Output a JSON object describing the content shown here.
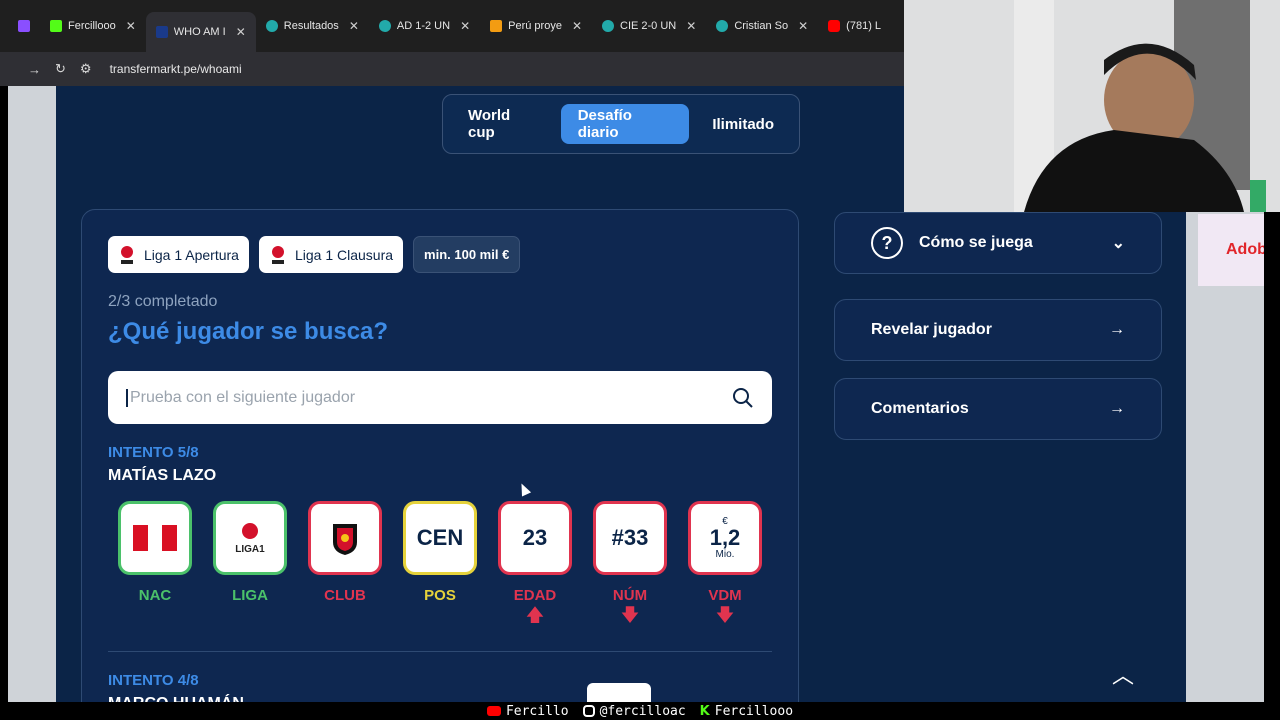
{
  "browser": {
    "tabs": [
      {
        "title": "",
        "fav_color": "#8a4fff",
        "active": false
      },
      {
        "title": "Fercillooo",
        "fav_color": "#53fc18",
        "active": false
      },
      {
        "title": "WHO AM I",
        "fav_color": "#1a3a8a",
        "active": true
      },
      {
        "title": "Resultados",
        "fav_color": "#2aa",
        "active": false
      },
      {
        "title": "AD 1-2 UN",
        "fav_color": "#2aa",
        "active": false
      },
      {
        "title": "Perú proye",
        "fav_color": "#f39c12",
        "active": false
      },
      {
        "title": "CIE 2-0 UN",
        "fav_color": "#2aa",
        "active": false
      },
      {
        "title": "Cristian So",
        "fav_color": "#2aa",
        "active": false
      },
      {
        "title": "(781) L",
        "fav_color": "#ff0000",
        "active": false
      }
    ],
    "url": "transfermarkt.pe/whoami"
  },
  "modes": [
    "World cup",
    "Desafío diario",
    "Ilimitado"
  ],
  "active_mode": "Desafío diario",
  "filters": [
    "Liga 1 Apertura",
    "Liga 1 Clausura",
    "min. 100 mil €"
  ],
  "progress": "2/3 completado",
  "question": "¿Qué jugador se busca?",
  "search": {
    "placeholder": "Prueba con el siguiente jugador"
  },
  "attempt_current": {
    "label": "INTENTO 5/8",
    "player": "MATÍAS LAZO",
    "tiles": [
      {
        "label": "NAC",
        "status": "green",
        "value": "",
        "arrow": ""
      },
      {
        "label": "LIGA",
        "status": "green",
        "value": "",
        "sub": "LIGA1",
        "arrow": ""
      },
      {
        "label": "CLUB",
        "status": "red",
        "value": "",
        "arrow": ""
      },
      {
        "label": "POS",
        "status": "yellow",
        "value": "CEN",
        "arrow": ""
      },
      {
        "label": "EDAD",
        "status": "red",
        "value": "23",
        "arrow": "up"
      },
      {
        "label": "NÚM",
        "status": "red",
        "value": "#33",
        "arrow": "down"
      },
      {
        "label": "VDM",
        "status": "red",
        "value": "1,2",
        "currency": "€",
        "unit": "Mio.",
        "arrow": "down"
      }
    ]
  },
  "attempt_prev": {
    "label": "INTENTO 4/8",
    "player": "MARCO HUAMÁN"
  },
  "side": {
    "how_to": "Cómo se juega",
    "reveal": "Revelar jugador",
    "comments": "Comentarios"
  },
  "ad_text": "Adob",
  "footer": {
    "youtube": "Fercillo",
    "instagram": "@fercilloac",
    "kick": "Fercillooo"
  },
  "colors": {
    "accent": "#3d8be6",
    "bg": "#0b2447",
    "correct": "#4bc16a",
    "wrong": "#e0344f",
    "partial": "#e5d23b"
  }
}
